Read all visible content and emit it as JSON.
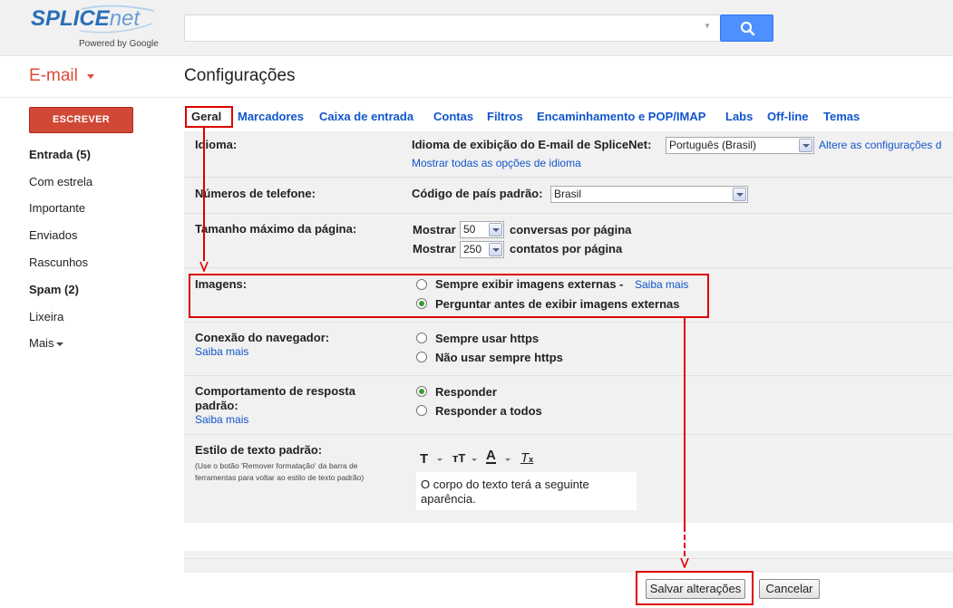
{
  "logo": {
    "brand_main": "SPLICE",
    "brand_thin": "net",
    "powered_by": "Powered by Google"
  },
  "search": {
    "placeholder": "",
    "value": ""
  },
  "header": {
    "app_label": "E-mail",
    "page_title": "Configurações"
  },
  "sidebar": {
    "compose_label": "ESCREVER",
    "items": [
      {
        "label": "Entrada (5)",
        "bold": true
      },
      {
        "label": "Com estrela",
        "bold": false
      },
      {
        "label": "Importante",
        "bold": false
      },
      {
        "label": "Enviados",
        "bold": false
      },
      {
        "label": "Rascunhos",
        "bold": false
      },
      {
        "label": "Spam (2)",
        "bold": true
      },
      {
        "label": "Lixeira",
        "bold": false
      },
      {
        "label": "Mais",
        "bold": false
      }
    ]
  },
  "tabs": [
    "Geral",
    "Marcadores",
    "Caixa de entrada",
    "Contas",
    "Filtros",
    "Encaminhamento e POP/IMAP",
    "Labs",
    "Off-line",
    "Temas"
  ],
  "settings": {
    "language": {
      "label": "Idioma:",
      "display_label": "Idioma de exibição do E-mail de SpliceNet:",
      "selected": "Português (Brasil)",
      "change_link": "Altere as configurações d",
      "all_options_link": "Mostrar todas as opções de idioma"
    },
    "phone": {
      "label": "Números de telefone:",
      "country_label": "Código de país padrão:",
      "selected": "Brasil"
    },
    "page_size": {
      "label": "Tamanho máximo da página:",
      "show_label": "Mostrar",
      "conversations_value": "50",
      "conversations_suffix": "conversas por página",
      "contacts_value": "250",
      "contacts_suffix": "contatos por página"
    },
    "images": {
      "label": "Imagens:",
      "option1": "Sempre exibir imagens externas -",
      "learn_more": "Saiba mais",
      "option2": "Perguntar antes de exibir imagens externas",
      "selected_option": 2
    },
    "browser_connection": {
      "label": "Conexão do navegador:",
      "learn_more": "Saiba mais",
      "option1": "Sempre usar https",
      "option2": "Não usar sempre https",
      "selected_option": 0
    },
    "reply_behavior": {
      "label": "Comportamento de resposta",
      "label_line2": "padrão:",
      "learn_more": "Saiba mais",
      "option1": "Responder",
      "option2": "Responder a todos",
      "selected_option": 1
    },
    "text_style": {
      "label": "Estilo de texto padrão:",
      "hint_line1": "(Use o botão 'Remover formatação' da barra de",
      "hint_line2": "ferramentas para voltar ao estilo de texto padrão)",
      "preview_line1": "O corpo do texto terá a seguinte",
      "preview_line2": "aparência."
    }
  },
  "footer": {
    "save_label": "Salvar alterações",
    "cancel_label": "Cancelar"
  },
  "colors": {
    "link": "#1155cc",
    "compose": "#d14836",
    "search_button": "#4d90fe",
    "annotation": "#dd0000",
    "radio_selected": "#3a9a3a"
  }
}
